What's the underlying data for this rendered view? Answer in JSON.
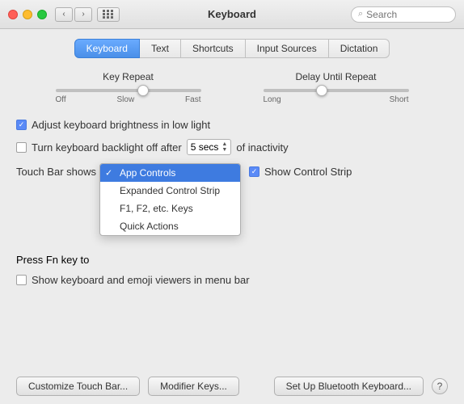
{
  "titlebar": {
    "title": "Keyboard",
    "search_placeholder": "Search"
  },
  "tabs": [
    {
      "id": "keyboard",
      "label": "Keyboard",
      "active": true
    },
    {
      "id": "text",
      "label": "Text",
      "active": false
    },
    {
      "id": "shortcuts",
      "label": "Shortcuts",
      "active": false
    },
    {
      "id": "input-sources",
      "label": "Input Sources",
      "active": false
    },
    {
      "id": "dictation",
      "label": "Dictation",
      "active": false
    }
  ],
  "sliders": {
    "key_repeat": {
      "label": "Key Repeat",
      "left_label": "Off",
      "left_sublabel": "Slow",
      "right_label": "Fast",
      "thumb_position": "60"
    },
    "delay_repeat": {
      "label": "Delay Until Repeat",
      "left_label": "Long",
      "right_label": "Short",
      "thumb_position": "40"
    }
  },
  "settings": {
    "adjust_brightness": {
      "label": "Adjust keyboard brightness in low light",
      "checked": true
    },
    "turn_off_backlight": {
      "label": "Turn keyboard backlight off after",
      "checked": false,
      "value": "5 secs",
      "suffix": "of inactivity"
    },
    "touchbar_show": {
      "label": "Touch Bar shows",
      "show_control_strip": {
        "label": "Show Control Strip",
        "checked": true
      }
    },
    "press_fn": {
      "label": "Press Fn key to"
    },
    "show_emoji": {
      "label": "Show keyboard and emoji viewers in menu bar",
      "checked": false
    }
  },
  "dropdown": {
    "selected": "App Controls",
    "items": [
      {
        "label": "App Controls",
        "selected": true
      },
      {
        "label": "Expanded Control Strip",
        "selected": false
      },
      {
        "label": "F1, F2, etc. Keys",
        "selected": false
      },
      {
        "label": "Quick Actions",
        "selected": false
      }
    ]
  },
  "buttons": {
    "customize_touch_bar": "Customize Touch Bar...",
    "modifier_keys": "Modifier Keys...",
    "set_up_bluetooth": "Set Up Bluetooth Keyboard...",
    "help": "?"
  },
  "icons": {
    "back": "‹",
    "forward": "›",
    "search": "🔍",
    "checkmark": "✓"
  }
}
